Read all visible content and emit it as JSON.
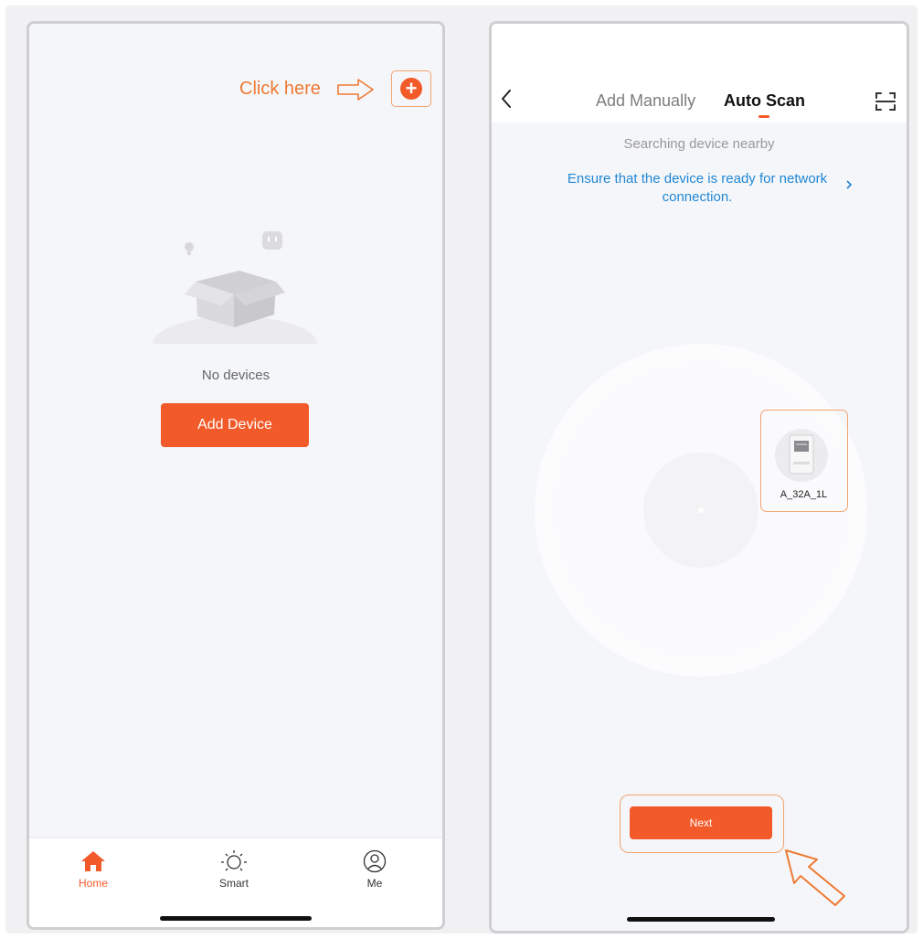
{
  "left_screen": {
    "hint_text": "Click here",
    "add_icon": "plus-circle-icon",
    "empty_state_text": "No devices",
    "add_device_label": "Add Device",
    "tabs": [
      {
        "label": "Home",
        "icon": "home-icon",
        "active": true
      },
      {
        "label": "Smart",
        "icon": "sun-icon",
        "active": false
      },
      {
        "label": "Me",
        "icon": "user-icon",
        "active": false
      }
    ]
  },
  "right_screen": {
    "tabs": [
      {
        "label": "Add Manually",
        "active": false
      },
      {
        "label": "Auto Scan",
        "active": true
      }
    ],
    "status_text": "Searching device nearby",
    "ensure_text": "Ensure that the device is ready for network connection.",
    "device": {
      "name": "A_32A_1L"
    },
    "next_label": "Next"
  },
  "colors": {
    "accent": "#f25a2a",
    "highlight": "#f3a36f",
    "link": "#1f87d6"
  }
}
